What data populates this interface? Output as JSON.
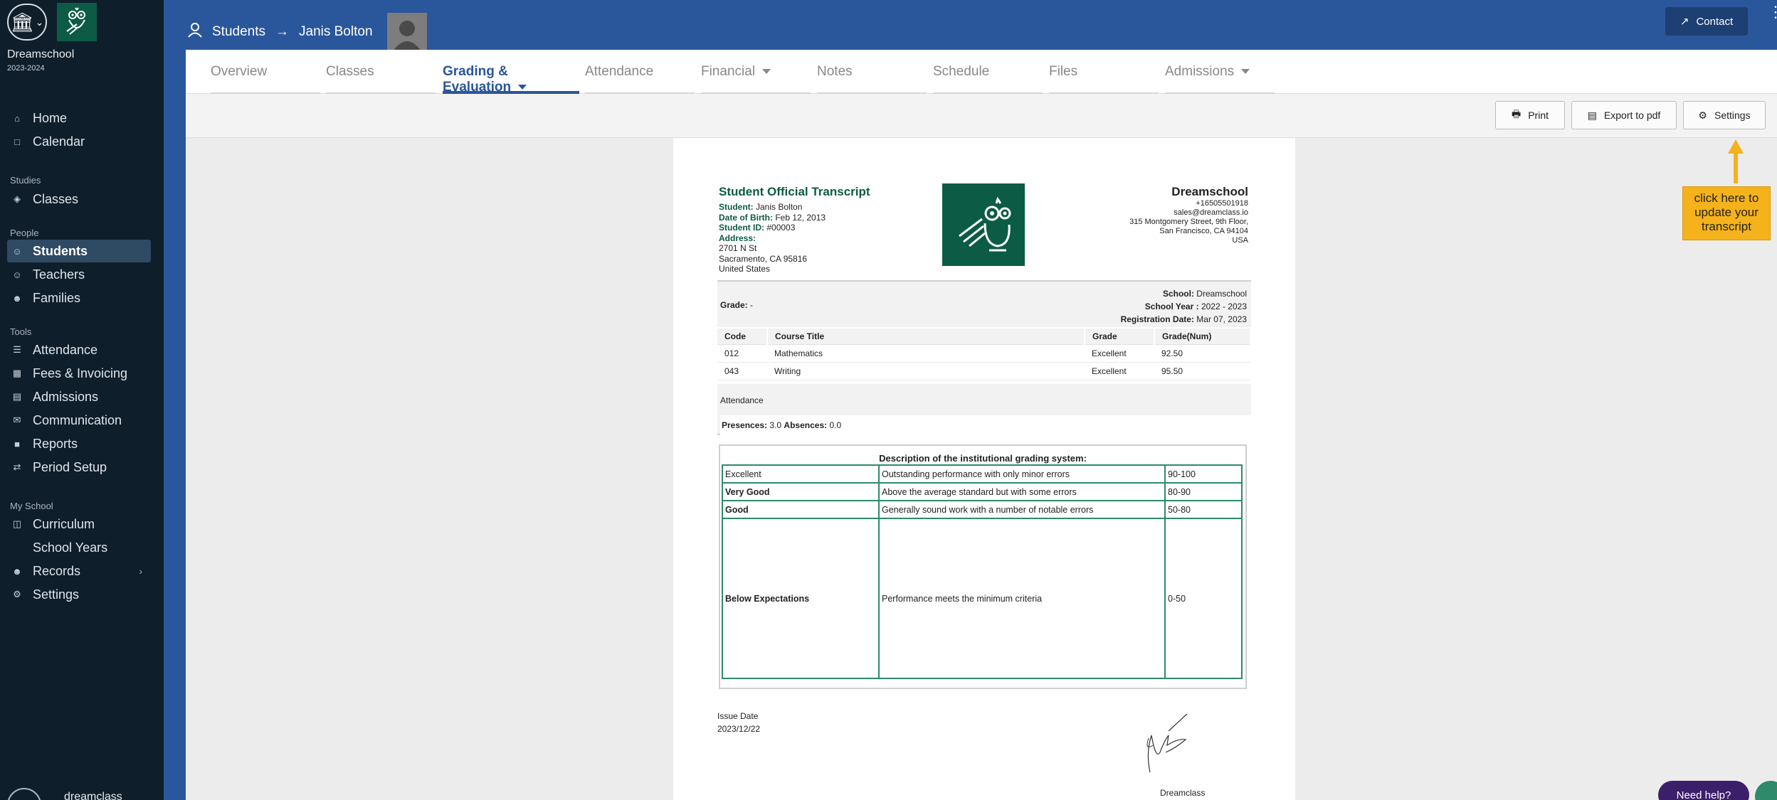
{
  "sidebar": {
    "school_name": "Dreamschool",
    "school_year": "2023-2024",
    "sections": {
      "studies": "Studies",
      "people": "People",
      "tools": "Tools",
      "my_school": "My School"
    },
    "items": {
      "home": "Home",
      "calendar": "Calendar",
      "classes": "Classes",
      "students": "Students",
      "teachers": "Teachers",
      "families": "Families",
      "attendance": "Attendance",
      "fees": "Fees & Invoicing",
      "admissions": "Admissions",
      "communication": "Communication",
      "reports": "Reports",
      "period_setup": "Period Setup",
      "curriculum": "Curriculum",
      "school_years": "School Years",
      "records": "Records",
      "settings": "Settings"
    },
    "user_name": "dreamclass"
  },
  "header": {
    "breadcrumb_root": "Students",
    "breadcrumb_current": "Janis Bolton",
    "contact_label": "Contact"
  },
  "tabs": {
    "overview": "Overview",
    "classes": "Classes",
    "grading": "Grading & Evaluation",
    "attendance": "Attendance",
    "financial": "Financial",
    "notes": "Notes",
    "schedule": "Schedule",
    "files": "Files",
    "admissions": "Admissions"
  },
  "toolbar": {
    "print": "Print",
    "export": "Export to pdf",
    "settings": "Settings"
  },
  "callout": {
    "line1": "click here to",
    "line2": "update your",
    "line3": "transcript"
  },
  "transcript": {
    "title": "Student Official Transcript",
    "student_label": "Student:",
    "student": "Janis Bolton",
    "dob_label": "Date of Birth:",
    "dob": "Feb 12, 2013",
    "id_label": "Student ID:",
    "id": "#00003",
    "address_label": "Address:",
    "address1": "2701 N St",
    "address2": "Sacramento, CA 95816",
    "address3": "United States",
    "school_name": "Dreamschool",
    "school_phone": "+16505501918",
    "school_email": "sales@dreamclass.io",
    "school_address1": "315 Montgomery Street, 9th Floor,",
    "school_address2": "San Francisco, CA 94104",
    "school_address3": "USA",
    "grade_label": "Grade:",
    "grade_value": "-",
    "school_label": "School:",
    "school_value": "Dreamschool",
    "school_year_label": "School Year :",
    "school_year_value": "2022 - 2023",
    "registration_label": "Registration Date:",
    "registration_value": "Mar 07, 2023",
    "courses_header": {
      "code": "Code",
      "title": "Course Title",
      "grade": "Grade",
      "grade_num": "Grade(Num)"
    },
    "courses": [
      {
        "code": "012",
        "title": "Mathematics",
        "grade": "Excellent",
        "grade_num": "92.50"
      },
      {
        "code": "043",
        "title": "Writing",
        "grade": "Excellent",
        "grade_num": "95.50"
      }
    ],
    "attendance_title": "Attendance",
    "presences_label": "Presences:",
    "presences_value": "3.0",
    "absences_label": "Absences:",
    "absences_value": "0.0",
    "grading_title": "Description of the institutional grading system:",
    "grading": [
      {
        "name": "Excellent",
        "desc": "Outstanding performance with only minor errors",
        "range": "90-100"
      },
      {
        "name": "Very Good",
        "desc": "Above the average standard but with some errors",
        "range": "80-90"
      },
      {
        "name": "Good",
        "desc": "Generally sound work with a number of notable errors",
        "range": "50-80"
      },
      {
        "name": "Below Expectations",
        "desc": "Performance meets the minimum criteria",
        "range": "0-50"
      }
    ],
    "issue_label": "Issue Date",
    "issue_date": "2023/12/22",
    "signer": "Dreamclass"
  },
  "help": {
    "label": "Need help?"
  },
  "colors": {
    "brand_blue": "#2a569b",
    "sidebar_bg": "#0f1e2b",
    "brand_green": "#0c5b45",
    "callout": "#f5b21a"
  }
}
